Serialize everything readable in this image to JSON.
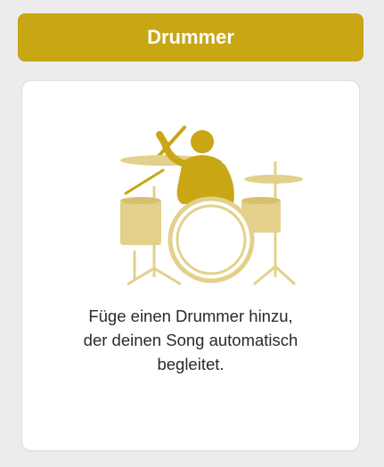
{
  "header": {
    "button_label": "Drummer"
  },
  "card": {
    "icon": "drummer-kit-icon",
    "description_lines": [
      "Füge einen Drummer hinzu,",
      "der deinen Song automatisch",
      "begleitet."
    ]
  },
  "colors": {
    "accent": "#c9a614",
    "illustration_dark": "#c9a614",
    "illustration_light": "#e3d08a",
    "card_background": "#ffffff",
    "page_background": "#ececec"
  }
}
